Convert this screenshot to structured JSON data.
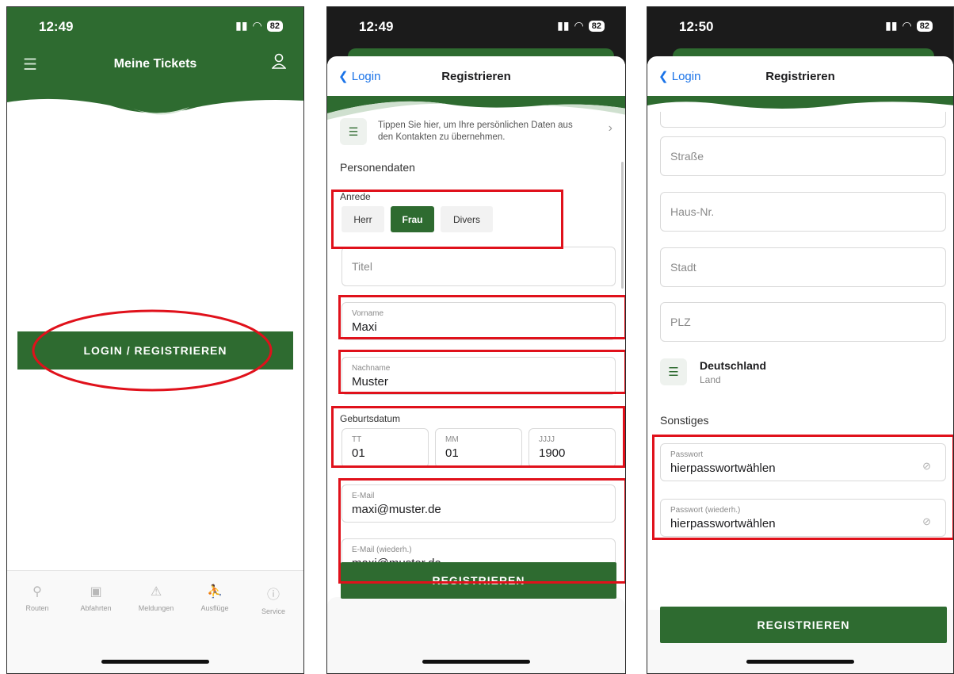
{
  "screen1": {
    "time": "12:49",
    "battery": "82",
    "title": "Meine Tickets",
    "login_button": "LOGIN / REGISTRIEREN",
    "tabs": [
      {
        "label": "Routen",
        "icon": "routes-icon"
      },
      {
        "label": "Abfahrten",
        "icon": "bus-icon"
      },
      {
        "label": "Meldungen",
        "icon": "warning-icon"
      },
      {
        "label": "Ausflüge",
        "icon": "hiker-icon"
      },
      {
        "label": "Service",
        "icon": "info-icon"
      }
    ]
  },
  "screen2": {
    "time": "12:49",
    "battery": "82",
    "back_label": "Login",
    "title": "Registrieren",
    "contacts_hint": "Tippen Sie hier, um Ihre persönlichen Daten aus den Kontakten zu übernehmen.",
    "section_person": "Personendaten",
    "salutation_label": "Anrede",
    "salutation_options": [
      "Herr",
      "Frau",
      "Divers"
    ],
    "salutation_selected": "Frau",
    "title_placeholder": "Titel",
    "firstname_label": "Vorname",
    "firstname_value": "Maxi",
    "lastname_label": "Nachname",
    "lastname_value": "Muster",
    "birthdate_label": "Geburtsdatum",
    "birth_day_label": "TT",
    "birth_day_value": "01",
    "birth_month_label": "MM",
    "birth_month_value": "01",
    "birth_year_label": "JJJJ",
    "birth_year_value": "1900",
    "email_label": "E-Mail",
    "email_value": "maxi@muster.de",
    "email_repeat_label": "E-Mail (wiederh.)",
    "email_repeat_value": "maxi@muster.de",
    "register_button": "REGISTRIEREN"
  },
  "screen3": {
    "time": "12:50",
    "battery": "82",
    "back_label": "Login",
    "title": "Registrieren",
    "street_placeholder": "Straße",
    "house_placeholder": "Haus-Nr.",
    "city_placeholder": "Stadt",
    "zip_placeholder": "PLZ",
    "country_value": "Deutschland",
    "country_label": "Land",
    "section_other": "Sonstiges",
    "password_label": "Passwort",
    "password_value": "hierpasswortwählen",
    "password_repeat_label": "Passwort (wiederh.)",
    "password_repeat_value": "hierpasswortwählen",
    "register_button": "REGISTRIEREN"
  },
  "colors": {
    "brand_green": "#2e6b30",
    "highlight_red": "#e0111b",
    "link_blue": "#1a73e8"
  }
}
